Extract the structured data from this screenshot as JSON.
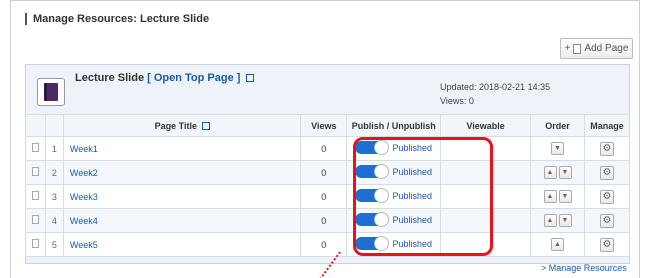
{
  "header": {
    "title": "Manage Resources: Lecture Slide",
    "add_page_label": "Add Page"
  },
  "resource": {
    "name": "Lecture Slide",
    "open_top_page": "[ Open Top Page ]",
    "updated": "Updated: 2018-02-21 14:35",
    "views": "Views: 0"
  },
  "table": {
    "headers": [
      "Page Title",
      "Views",
      "Publish / Unpublish",
      "Viewable",
      "Order",
      "Manage"
    ],
    "rows": [
      {
        "num": "1",
        "title": "Week1",
        "views": "0",
        "status": "Published",
        "order": [
          "▼"
        ]
      },
      {
        "num": "2",
        "title": "Week2",
        "views": "0",
        "status": "Published",
        "order": [
          "▲",
          "▼"
        ]
      },
      {
        "num": "3",
        "title": "Week3",
        "views": "0",
        "status": "Published",
        "order": [
          "▲",
          "▼"
        ]
      },
      {
        "num": "4",
        "title": "Week4",
        "views": "0",
        "status": "Published",
        "order": [
          "▲",
          "▼"
        ]
      },
      {
        "num": "5",
        "title": "Week5",
        "views": "0",
        "status": "Published",
        "order": [
          "▲"
        ]
      }
    ]
  },
  "footer": {
    "manage_resources": "> Manage Resources"
  },
  "colors": {
    "accent": "#1f6fd1",
    "link": "#1a5aa8",
    "highlight": "#e8121b"
  }
}
